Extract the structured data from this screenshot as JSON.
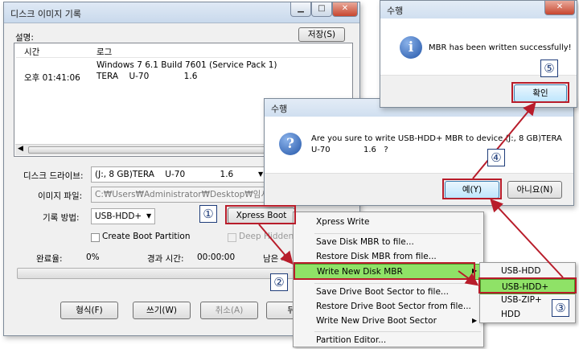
{
  "main_window": {
    "title": "디스크 이미지 기록",
    "description_label": "설명:",
    "save_button": "저장(S)",
    "log_headers": [
      "시간",
      "로그"
    ],
    "log_rows": [
      {
        "time": "",
        "message": "Windows 7 6.1 Build 7601 (Service Pack 1)"
      },
      {
        "time": "오후 01:41:06",
        "message": "TERA    U-70             1.6"
      }
    ],
    "drive_label": "디스크 드라이브:",
    "drive_value": "(J:, 8 GB)TERA    U-70             1.6",
    "image_file_label": "이미지 파일:",
    "image_file_value": "C:₩Users₩Administrator₩Desktop₩임시폴더₩",
    "write_method_label": "기록 방법:",
    "write_method_value": "USB-HDD+",
    "xpress_boot_button": "Xpress Boot",
    "create_boot_partition": "Create Boot Partition",
    "deep_hidden": "Deep Hidden",
    "done_label": "완료율:",
    "done_value": "0%",
    "elapsed_label": "경과 시간:",
    "elapsed_value": "00:00:00",
    "remaining_label": "남은 시",
    "buttons": {
      "format": "형식(F)",
      "write": "쓰기(W)",
      "cancel": "취소(A)",
      "back": "뒤로"
    }
  },
  "context_menu": {
    "items": [
      "Xpress Write",
      "Save Disk MBR to file...",
      "Restore Disk MBR from file...",
      "Write New Disk MBR",
      "Save Drive Boot Sector to file...",
      "Restore Drive Boot Sector from file...",
      "Write New Drive Boot Sector",
      "Partition Editor..."
    ]
  },
  "submenu": {
    "items": [
      "USB-HDD",
      "USB-HDD+",
      "USB-ZIP+",
      "HDD"
    ]
  },
  "confirm_dialog": {
    "title": "수행",
    "message_line1": "Are you sure to write USB-HDD+ MBR to device (J:, 8 GB)TERA",
    "message_line2": "U-70             1.6   ?",
    "yes_button": "예(Y)",
    "no_button": "아니요(N)"
  },
  "success_dialog": {
    "title": "수행",
    "message": "MBR has been written successfully!",
    "ok_button": "확인"
  },
  "markers": [
    "①",
    "②",
    "③",
    "④",
    "⑤"
  ],
  "colors": {
    "highlight": "#8fe267",
    "annotation_red": "#b81c2a",
    "marker_blue": "#1f3d7a"
  }
}
